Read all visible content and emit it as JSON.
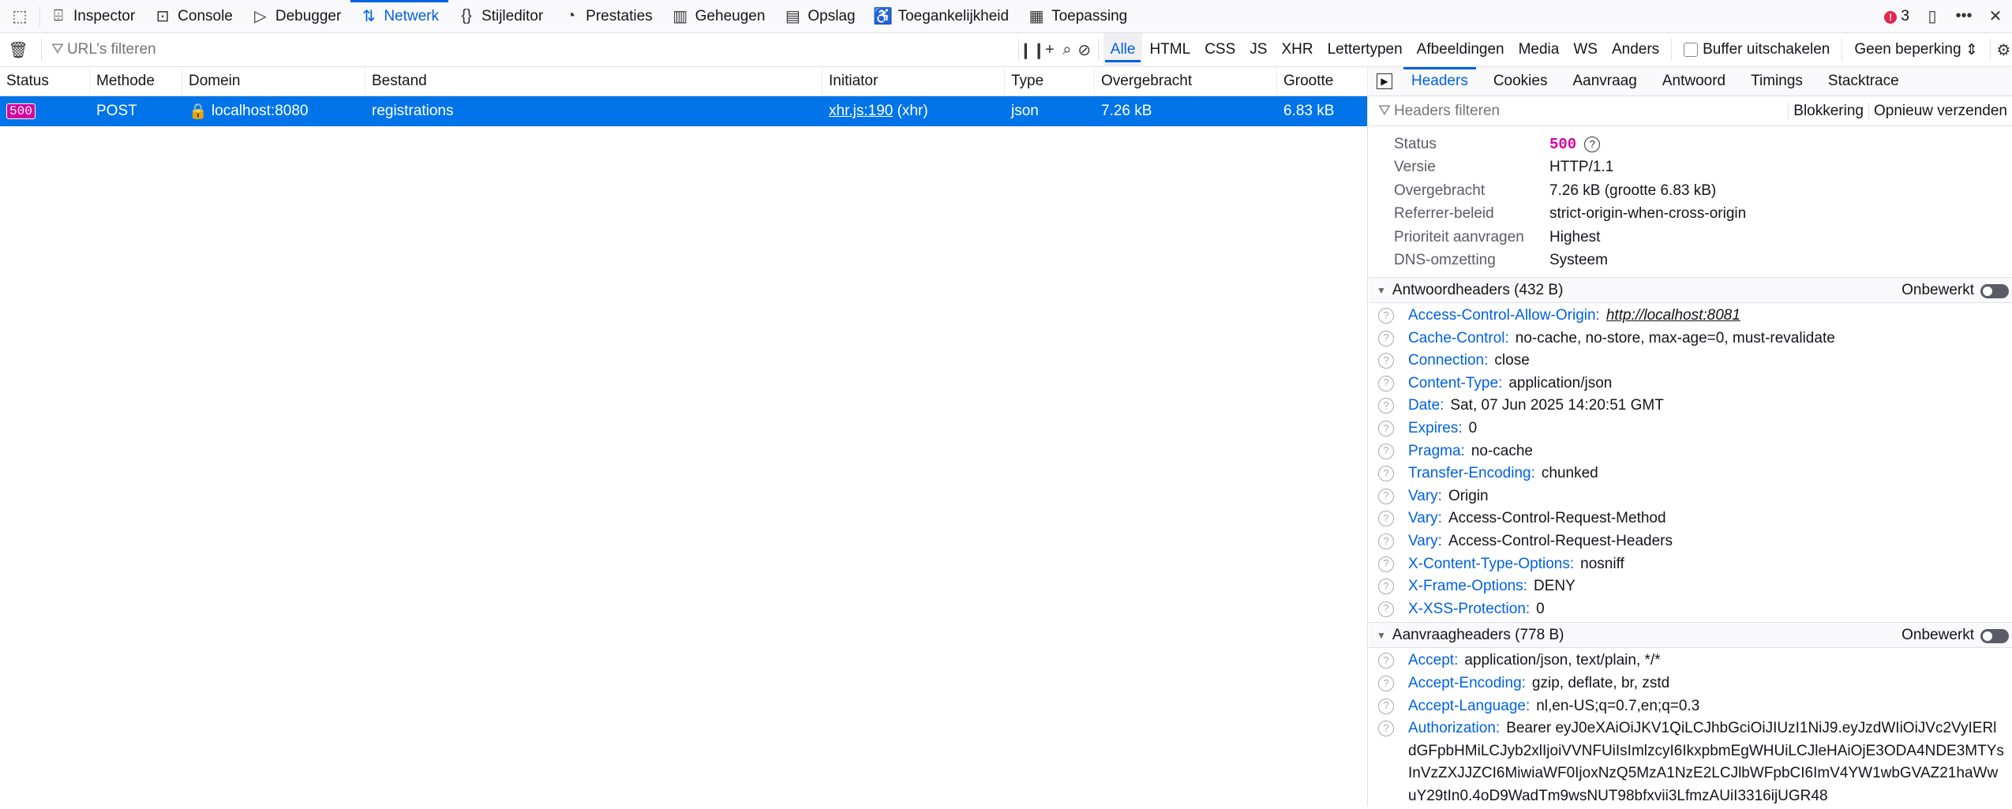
{
  "toolbar": {
    "tabs": [
      {
        "label": "Inspector",
        "icon": "inspector-icon"
      },
      {
        "label": "Console",
        "icon": "console-icon"
      },
      {
        "label": "Debugger",
        "icon": "debugger-icon"
      },
      {
        "label": "Netwerk",
        "icon": "network-icon"
      },
      {
        "label": "Stijleditor",
        "icon": "style-editor-icon"
      },
      {
        "label": "Prestaties",
        "icon": "performance-icon"
      },
      {
        "label": "Geheugen",
        "icon": "memory-icon"
      },
      {
        "label": "Opslag",
        "icon": "storage-icon"
      },
      {
        "label": "Toegankelijkheid",
        "icon": "accessibility-icon"
      },
      {
        "label": "Toepassing",
        "icon": "application-icon"
      }
    ],
    "error_count": "3",
    "accent": "#0061e0"
  },
  "filter": {
    "placeholder": "URL’s filteren",
    "types": [
      "Alle",
      "HTML",
      "CSS",
      "JS",
      "XHR",
      "Lettertypen",
      "Afbeeldingen",
      "Media",
      "WS",
      "Anders"
    ],
    "buffer_label": "Buffer uitschakelen",
    "throttle": "Geen beperking"
  },
  "table": {
    "columns": [
      "Status",
      "Methode",
      "Domein",
      "Bestand",
      "Initiator",
      "Type",
      "Overgebracht",
      "Grootte"
    ],
    "rows": [
      {
        "status": "500",
        "method": "POST",
        "domain": "localhost:8080",
        "file": "registrations",
        "initiator": "xhr.js:190",
        "initiator_type": "(xhr)",
        "type": "json",
        "transferred": "7.26 kB",
        "size": "6.83 kB"
      }
    ]
  },
  "panel": {
    "tabs": [
      "Headers",
      "Cookies",
      "Aanvraag",
      "Antwoord",
      "Timings",
      "Stacktrace"
    ],
    "filter_placeholder": "Headers filteren",
    "block_label": "Blokkering",
    "resend_label": "Opnieuw verzenden",
    "summary": [
      {
        "label": "Status",
        "value": "500"
      },
      {
        "label": "Versie",
        "value": "HTTP/1.1"
      },
      {
        "label": "Overgebracht",
        "value": "7.26 kB (grootte 6.83 kB)"
      },
      {
        "label": "Referrer-beleid",
        "value": "strict-origin-when-cross-origin"
      },
      {
        "label": "Prioriteit aanvragen",
        "value": "Highest"
      },
      {
        "label": "DNS-omzetting",
        "value": "Systeem"
      }
    ],
    "response_title": "Antwoordheaders (432 B)",
    "raw_label": "Onbewerkt",
    "response_headers": [
      {
        "name": "Access-Control-Allow-Origin:",
        "value": "http://localhost:8081"
      },
      {
        "name": "Cache-Control:",
        "value": "no-cache, no-store, max-age=0, must-revalidate"
      },
      {
        "name": "Connection:",
        "value": "close"
      },
      {
        "name": "Content-Type:",
        "value": "application/json"
      },
      {
        "name": "Date:",
        "value": "Sat, 07 Jun 2025 14:20:51 GMT"
      },
      {
        "name": "Expires:",
        "value": "0"
      },
      {
        "name": "Pragma:",
        "value": "no-cache"
      },
      {
        "name": "Transfer-Encoding:",
        "value": "chunked"
      },
      {
        "name": "Vary:",
        "value": "Origin"
      },
      {
        "name": "Vary:",
        "value": "Access-Control-Request-Method"
      },
      {
        "name": "Vary:",
        "value": "Access-Control-Request-Headers"
      },
      {
        "name": "X-Content-Type-Options:",
        "value": "nosniff"
      },
      {
        "name": "X-Frame-Options:",
        "value": "DENY"
      },
      {
        "name": "X-XSS-Protection:",
        "value": "0"
      }
    ],
    "request_title": "Aanvraagheaders (778 B)",
    "request_headers": [
      {
        "name": "Accept:",
        "value": "application/json, text/plain, */*"
      },
      {
        "name": "Accept-Encoding:",
        "value": "gzip, deflate, br, zstd"
      },
      {
        "name": "Accept-Language:",
        "value": "nl,en-US;q=0.7,en;q=0.3"
      },
      {
        "name": "Authorization:",
        "value": "Bearer eyJ0eXAiOiJKV1QiLCJhbGciOiJIUzI1NiJ9.eyJzdWIiOiJVc2VyIERldGFpbHMiLCJyb2xlIjoiVVNFUiIsImlzcyI6IkxpbmEgWHUiLCJleHAiOjE3ODA4NDE3MTYsInVzZXJJZCI6MiwiaWF0IjoxNzQ5MzA1NzE2LCJlbWFpbCI6ImV4YW1wbGVAZ21haWwuY29tIn0.4oD9WadTm9wsNUT98bfxvii3LfmzAUiI3316ijUGR48"
      }
    ]
  },
  "status_color": "#d6009f"
}
